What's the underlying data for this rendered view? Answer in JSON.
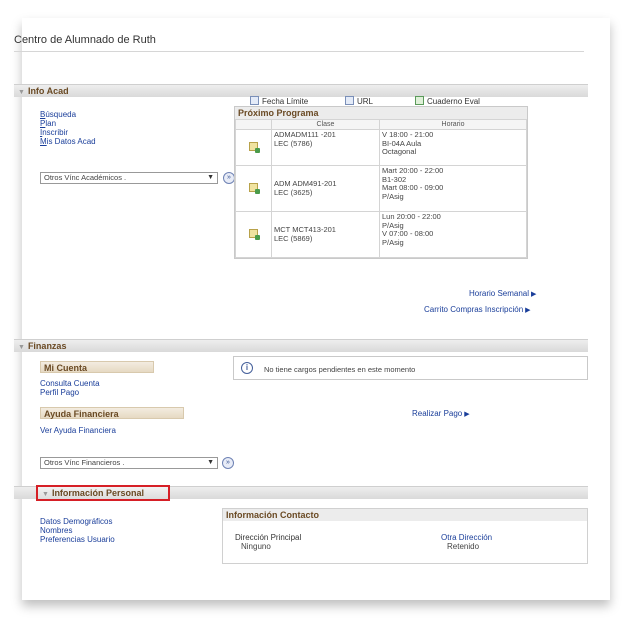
{
  "page_title": "Centro de Alumnado de Ruth",
  "sections": {
    "info_acad": "Info Acad",
    "finanzas": "Finanzas",
    "personal": "Información Personal"
  },
  "acad_links": [
    {
      "first": "B",
      "rest": "úsqueda"
    },
    {
      "first": "P",
      "rest": "lan"
    },
    {
      "first": "I",
      "rest": "nscribir"
    },
    {
      "first": "M",
      "rest": "is Datos Acad"
    }
  ],
  "acad_select": "Otros Vínc Académicos .",
  "toolbar": {
    "deadline": "Fecha Límite",
    "url": "URL",
    "gradebook": "Cuaderno Eval"
  },
  "schedule": {
    "title": "Próximo Programa",
    "col_class": "Clase",
    "col_schedule": "Horario",
    "rows": [
      {
        "class1": "ADMADM111 -201",
        "class2": "LEC (5786)",
        "times": [
          "V 18:00 - 21:00",
          "BI-04A Aula",
          "Octagonal"
        ]
      },
      {
        "class1": "ADM ADM491-201",
        "class2": "LEC (3625)",
        "times": [
          "Mart 20:00 - 22:00",
          "B1-302",
          "Mart 08:00 - 09:00",
          "P/Asig"
        ]
      },
      {
        "class1": "MCT MCT413-201",
        "class2": "LEC (5869)",
        "times": [
          "Lun 20:00 - 22:00",
          "P/Asig",
          "V 07:00 - 08:00",
          "P/Asig"
        ]
      }
    ],
    "weekly_link": "Horario Semanal",
    "cart_link": "Carrito Compras Inscripción"
  },
  "finanzas": {
    "account_head": "Mi Cuenta",
    "account_links": [
      "Consulta Cuenta",
      "Perfil Pago"
    ],
    "aid_head": "Ayuda Financiera",
    "aid_links": [
      "Ver Ayuda Financiera"
    ],
    "message": "No tiene cargos pendientes en este momento",
    "pay_link": "Realizar Pago",
    "select": "Otros Vínc Financieros ."
  },
  "personal": {
    "links": [
      "Datos Demográficos",
      "Nombres",
      "Preferencias Usuario"
    ],
    "contact_head": "Información Contacto",
    "main_address_label": "Dirección Principal",
    "main_address_value": "Ninguno",
    "other_address_label": "Otra Dirección",
    "other_address_value": "Retenido"
  }
}
